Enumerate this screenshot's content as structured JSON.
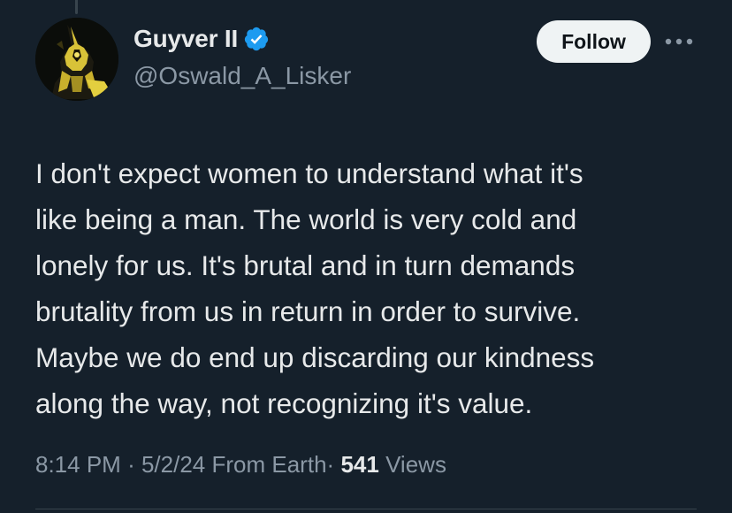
{
  "author": {
    "display_name": "Guyver II",
    "handle": "@Oswald_A_Lisker",
    "avatar_icon": "guyver-armor-avatar",
    "verified_icon": "verified-badge-icon",
    "verified_color": "#1d9bf0"
  },
  "actions": {
    "follow_label": "Follow",
    "more_icon": "more-options-icon"
  },
  "tweet": {
    "lines": [
      "I don't expect women to understand what it's",
      "like being a man. The world is very cold and",
      "lonely for us. It's brutal and in turn demands",
      "brutality from us in return in order to survive.",
      "Maybe we do end up discarding our kindness",
      "along the way, not recognizing it's value."
    ]
  },
  "meta": {
    "time": "8:14 PM",
    "sep1": "·",
    "date": "5/2/24",
    "location": "From Earth",
    "sep2": "·",
    "views_count": "541",
    "views_label": "Views"
  },
  "colors": {
    "background": "#15202b",
    "text": "#e7e9ea",
    "secondary_text": "#8b98a5",
    "follow_bg": "#eff3f4"
  }
}
